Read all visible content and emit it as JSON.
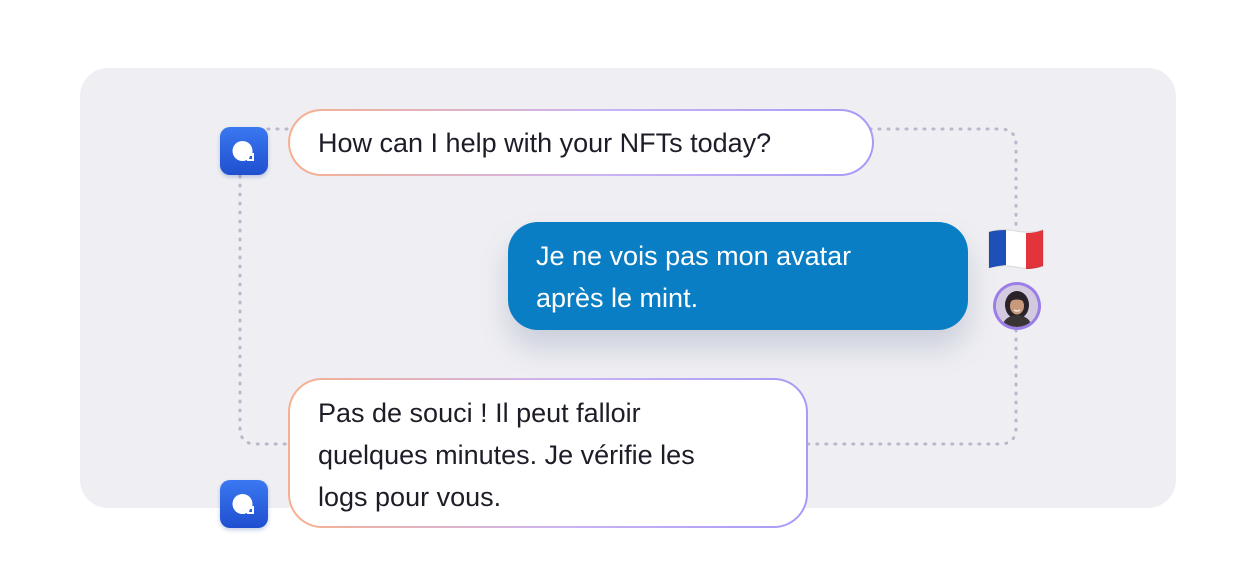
{
  "conversation": {
    "messages": [
      {
        "role": "bot",
        "text": "How can I help with your NFTs today?"
      },
      {
        "role": "user",
        "text": "Je ne vois pas mon avatar après le mint.",
        "lines": [
          "Je ne vois pas mon avatar",
          "après le mint."
        ]
      },
      {
        "role": "bot",
        "text": "Pas de souci ! Il peut falloir quelques minutes. Je vérifie les logs pour vous.",
        "lines": [
          "Pas de souci ! Il peut falloir",
          "quelques minutes. Je vérifie les",
          "logs pour vous."
        ]
      }
    ],
    "user_language_flag": "france-flag-icon",
    "bot_avatar_icon": "chat-bubble-icon",
    "user_avatar": "user-avatar-photo"
  },
  "colors": {
    "panel_background": "#efeff3",
    "user_bubble": "#0a7ec4",
    "bot_avatar": "#2b63e0",
    "bubble_border_start": "#f6b08e",
    "bubble_border_end": "#a89af5",
    "connector_dots": "#b8b8cc"
  }
}
